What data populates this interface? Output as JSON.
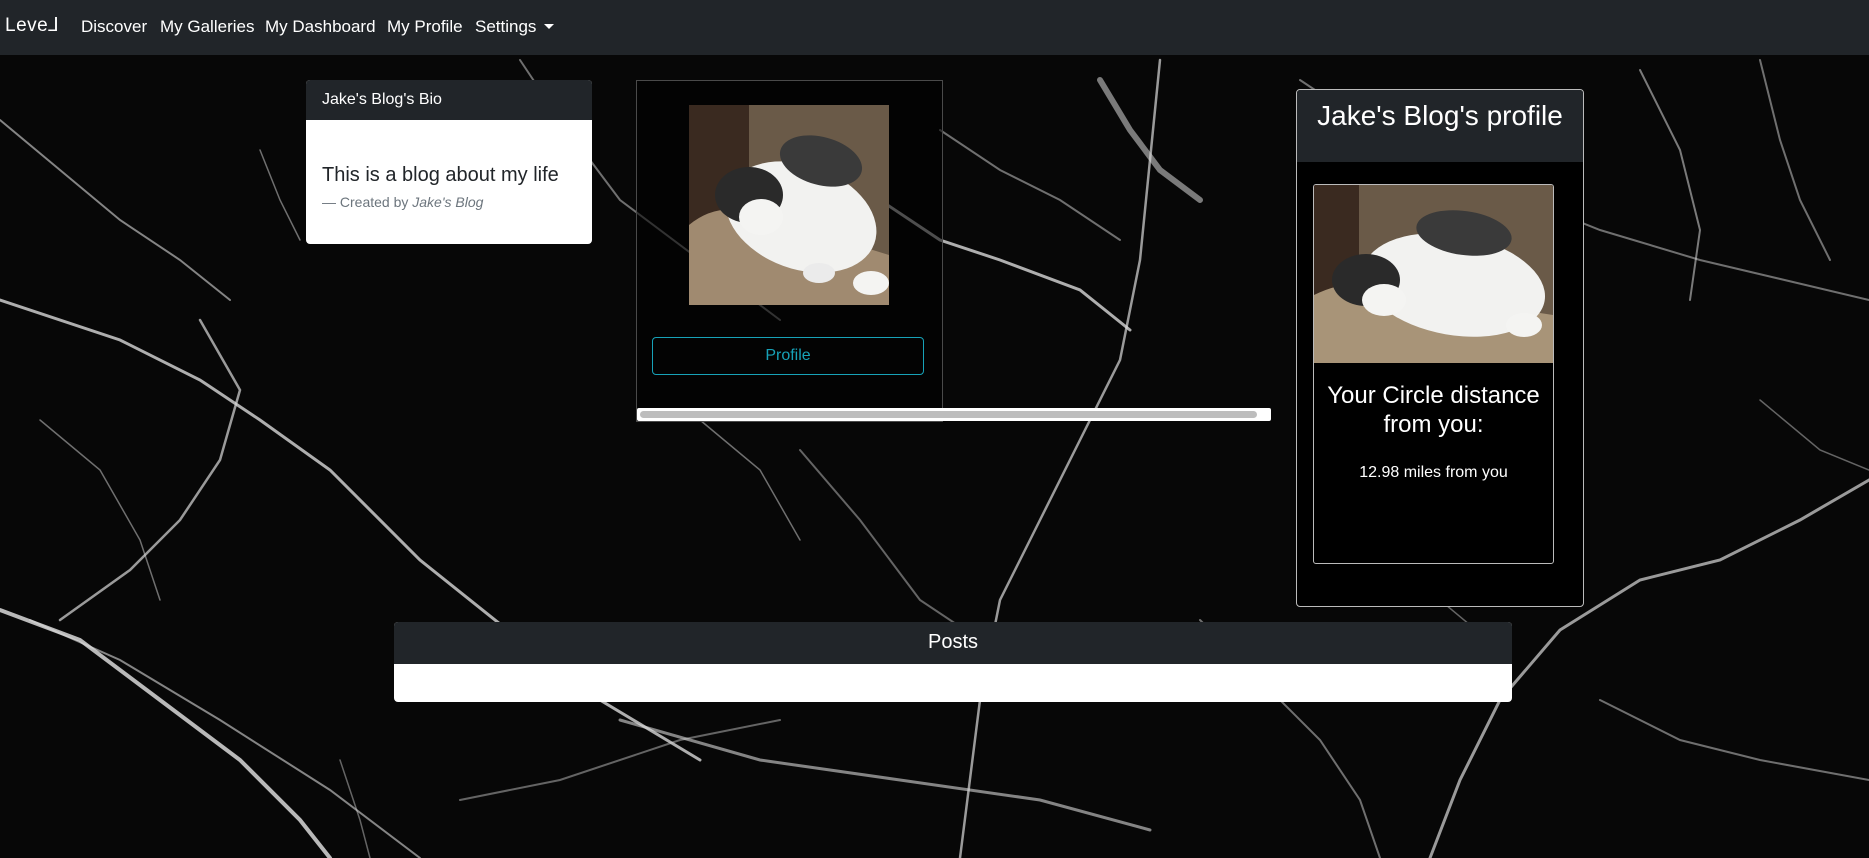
{
  "nav": {
    "brand": "Leve⅃",
    "links": [
      "Discover",
      "My Galleries",
      "My Dashboard",
      "My Profile"
    ],
    "settings": "Settings"
  },
  "bio": {
    "header": "Jake's Blog's Bio",
    "text": "This is a blog about my life",
    "footer_prefix": "— Created by",
    "author": "Jake's Blog"
  },
  "middle": {
    "image_alt": "cat photo",
    "profile_button": "Profile"
  },
  "profile": {
    "title": "Jake's Blog's profile",
    "circle_title": "Your Circle distance from you:",
    "distance": "12.98 miles from you"
  },
  "posts": {
    "header": "Posts"
  },
  "colors": {
    "navbar": "#212529",
    "accent": "#17a2b8",
    "background": "#050505"
  },
  "icons": {
    "settings_caret": "caret-down-icon"
  }
}
